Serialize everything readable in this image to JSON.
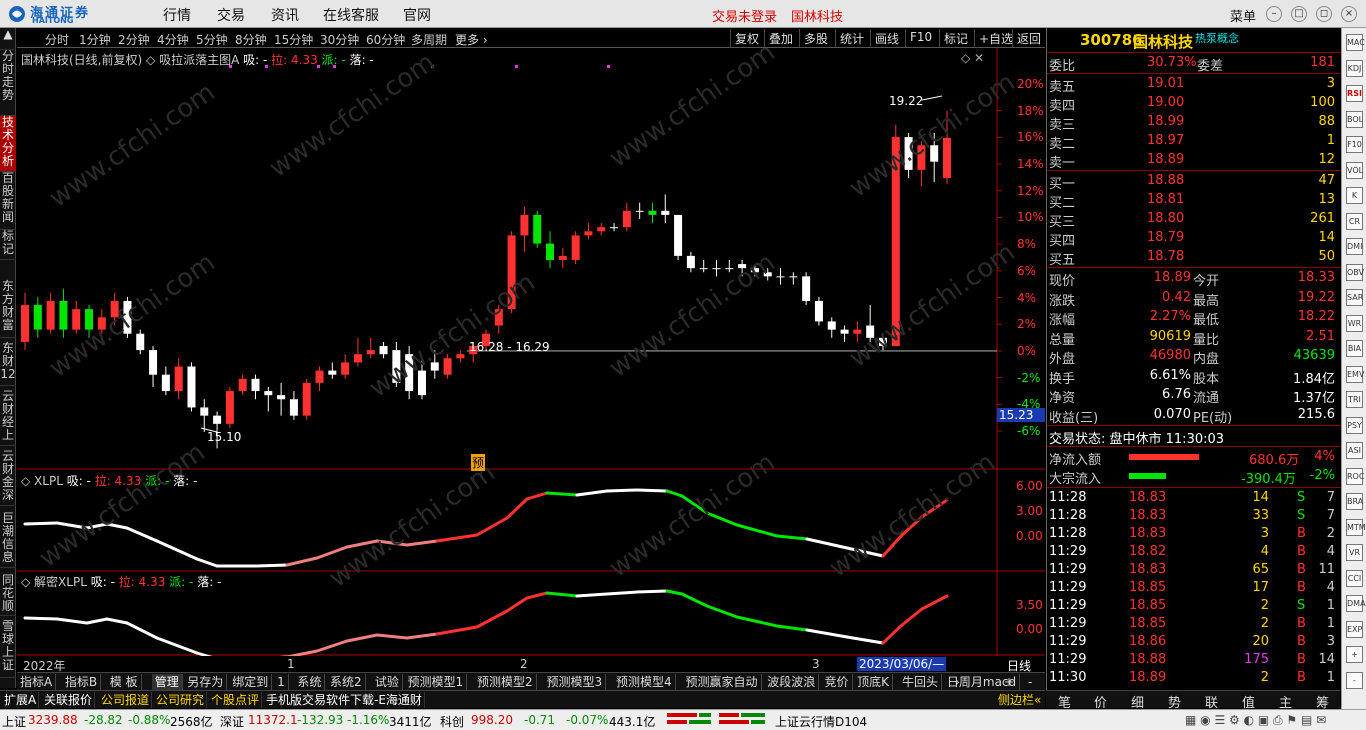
{
  "topbar": {
    "logo_cn": "海通证券",
    "logo_en": "HAITONG",
    "menus": [
      "行情",
      "交易",
      "资讯",
      "在线客服",
      "官网"
    ],
    "login_text": "交易未登录",
    "stock_name": "国林科技",
    "menu_label": "菜单"
  },
  "left_tabs": [
    "分时走势",
    "技术分析",
    "百股新闻",
    "标记",
    "东方财富",
    "东财12",
    "云财经上",
    "云财金深",
    "巨潮信息",
    "同花顺",
    "雪球上证"
  ],
  "periods": [
    "分时",
    "1分钟",
    "2分钟",
    "4分钟",
    "5分钟",
    "8分钟",
    "15分钟",
    "30分钟",
    "60分钟",
    "多周期",
    "更多"
  ],
  "toolbar": [
    "复权",
    "叠加",
    "多股",
    "统计",
    "画线",
    "F10",
    "标记",
    "+自选",
    "返回"
  ],
  "main_chart": {
    "title_name": "国林科技(日线,前复权)",
    "indicator": "吸拉派落主图A",
    "xi": "吸: -",
    "la": "拉: 4.33",
    "pai": "派: -",
    "luo": "落: -",
    "high_label": "19.22",
    "low_label": "15.10",
    "line_label": "16.28 - 16.29",
    "yu_marker": "预",
    "current_price_tag": "15.23",
    "axis_labels": [
      "20%",
      "18%",
      "16%",
      "14%",
      "12%",
      "10%",
      "8%",
      "6%",
      "4%",
      "2%",
      "0%",
      "-2%",
      "-4%",
      "-6%"
    ]
  },
  "chart_data": {
    "type": "candlestick",
    "ylim_percent": [
      -6,
      20
    ],
    "base_price": 16.29,
    "candles": [
      {
        "o": 16.4,
        "c": 16.85,
        "h": 17.0,
        "l": 16.3
      },
      {
        "o": 16.85,
        "c": 16.55,
        "h": 16.95,
        "l": 16.45
      },
      {
        "o": 16.55,
        "c": 16.9,
        "h": 17.0,
        "l": 16.5
      },
      {
        "o": 16.9,
        "c": 16.55,
        "h": 17.05,
        "l": 16.45
      },
      {
        "o": 16.55,
        "c": 16.8,
        "h": 16.9,
        "l": 16.5
      },
      {
        "o": 16.8,
        "c": 16.55,
        "h": 16.85,
        "l": 16.45
      },
      {
        "o": 16.55,
        "c": 16.7,
        "h": 16.8,
        "l": 16.5
      },
      {
        "o": 16.7,
        "c": 16.9,
        "h": 17.0,
        "l": 16.6
      },
      {
        "o": 16.9,
        "c": 16.5,
        "h": 16.95,
        "l": 16.45
      },
      {
        "o": 16.5,
        "c": 16.3,
        "h": 16.55,
        "l": 16.25
      },
      {
        "o": 16.3,
        "c": 16.0,
        "h": 16.35,
        "l": 15.85
      },
      {
        "o": 16.0,
        "c": 15.8,
        "h": 16.1,
        "l": 15.75
      },
      {
        "o": 15.8,
        "c": 16.1,
        "h": 16.2,
        "l": 15.7
      },
      {
        "o": 16.1,
        "c": 15.6,
        "h": 16.15,
        "l": 15.55
      },
      {
        "o": 15.6,
        "c": 15.5,
        "h": 15.7,
        "l": 15.3
      },
      {
        "o": 15.5,
        "c": 15.4,
        "h": 15.55,
        "l": 15.1
      },
      {
        "o": 15.4,
        "c": 15.8,
        "h": 15.85,
        "l": 15.35
      },
      {
        "o": 15.8,
        "c": 15.95,
        "h": 16.0,
        "l": 15.75
      },
      {
        "o": 15.95,
        "c": 15.8,
        "h": 16.0,
        "l": 15.7
      },
      {
        "o": 15.8,
        "c": 15.75,
        "h": 15.85,
        "l": 15.55
      },
      {
        "o": 15.75,
        "c": 15.7,
        "h": 15.9,
        "l": 15.5
      },
      {
        "o": 15.7,
        "c": 15.5,
        "h": 15.8,
        "l": 15.45
      },
      {
        "o": 15.5,
        "c": 15.9,
        "h": 15.95,
        "l": 15.45
      },
      {
        "o": 15.9,
        "c": 16.05,
        "h": 16.1,
        "l": 15.8
      },
      {
        "o": 16.05,
        "c": 16.0,
        "h": 16.15,
        "l": 15.95
      },
      {
        "o": 16.0,
        "c": 16.15,
        "h": 16.25,
        "l": 15.95
      },
      {
        "o": 16.15,
        "c": 16.25,
        "h": 16.45,
        "l": 16.1
      },
      {
        "o": 16.25,
        "c": 16.3,
        "h": 16.45,
        "l": 16.2
      },
      {
        "o": 16.35,
        "c": 16.25,
        "h": 16.4,
        "l": 16.2
      },
      {
        "o": 16.3,
        "c": 15.9,
        "h": 16.4,
        "l": 15.85
      },
      {
        "o": 16.25,
        "c": 15.8,
        "h": 16.35,
        "l": 15.7
      },
      {
        "o": 16.05,
        "c": 15.75,
        "h": 16.2,
        "l": 15.7
      },
      {
        "o": 16.15,
        "c": 16.05,
        "h": 16.3,
        "l": 15.95
      },
      {
        "o": 16.0,
        "c": 16.2,
        "h": 16.25,
        "l": 15.95
      },
      {
        "o": 16.2,
        "c": 16.25,
        "h": 16.3,
        "l": 16.15
      },
      {
        "o": 16.25,
        "c": 16.35,
        "h": 16.4,
        "l": 16.15
      },
      {
        "o": 16.35,
        "c": 16.5,
        "h": 16.55,
        "l": 16.3
      },
      {
        "o": 16.6,
        "c": 16.8,
        "h": 16.85,
        "l": 16.5
      },
      {
        "o": 16.8,
        "c": 17.7,
        "h": 17.75,
        "l": 16.75
      },
      {
        "o": 17.7,
        "c": 17.95,
        "h": 18.05,
        "l": 17.5
      },
      {
        "o": 17.95,
        "c": 17.6,
        "h": 18.0,
        "l": 17.55
      },
      {
        "o": 17.6,
        "c": 17.4,
        "h": 17.75,
        "l": 17.3
      },
      {
        "o": 17.4,
        "c": 17.45,
        "h": 17.55,
        "l": 17.3
      },
      {
        "o": 17.4,
        "c": 17.7,
        "h": 17.75,
        "l": 17.35
      },
      {
        "o": 17.7,
        "c": 17.75,
        "h": 17.85,
        "l": 17.65
      },
      {
        "o": 17.75,
        "c": 17.8,
        "h": 17.85,
        "l": 17.7
      },
      {
        "o": 17.8,
        "c": 17.8,
        "h": 17.85,
        "l": 17.75
      },
      {
        "o": 17.8,
        "c": 18.0,
        "h": 18.1,
        "l": 17.75
      },
      {
        "o": 18.0,
        "c": 18.0,
        "h": 18.1,
        "l": 17.9
      },
      {
        "o": 18.0,
        "c": 17.95,
        "h": 18.1,
        "l": 17.85
      },
      {
        "o": 18.0,
        "c": 17.95,
        "h": 18.2,
        "l": 17.85
      },
      {
        "o": 17.95,
        "c": 17.45,
        "h": 17.95,
        "l": 17.4
      },
      {
        "o": 17.45,
        "c": 17.3,
        "h": 17.5,
        "l": 17.25
      },
      {
        "o": 17.3,
        "c": 17.3,
        "h": 17.4,
        "l": 17.25
      },
      {
        "o": 17.3,
        "c": 17.3,
        "h": 17.4,
        "l": 17.2
      },
      {
        "o": 17.3,
        "c": 17.3,
        "h": 17.4,
        "l": 17.25
      },
      {
        "o": 17.35,
        "c": 17.3,
        "h": 17.4,
        "l": 17.2
      },
      {
        "o": 17.3,
        "c": 17.25,
        "h": 17.35,
        "l": 17.2
      },
      {
        "o": 17.25,
        "c": 17.2,
        "h": 17.3,
        "l": 17.15
      },
      {
        "o": 17.2,
        "c": 17.2,
        "h": 17.3,
        "l": 17.1
      },
      {
        "o": 17.2,
        "c": 17.2,
        "h": 17.25,
        "l": 17.1
      },
      {
        "o": 17.2,
        "c": 16.9,
        "h": 17.25,
        "l": 16.85
      },
      {
        "o": 16.9,
        "c": 16.65,
        "h": 16.95,
        "l": 16.6
      },
      {
        "o": 16.65,
        "c": 16.55,
        "h": 16.7,
        "l": 16.45
      },
      {
        "o": 16.55,
        "c": 16.5,
        "h": 16.6,
        "l": 16.4
      },
      {
        "o": 16.5,
        "c": 16.55,
        "h": 16.65,
        "l": 16.4
      },
      {
        "o": 16.6,
        "c": 16.45,
        "h": 16.85,
        "l": 16.4
      },
      {
        "o": 16.45,
        "c": 16.35,
        "h": 16.5,
        "l": 16.3
      },
      {
        "o": 16.35,
        "c": 18.9,
        "h": 19.05,
        "l": 16.35
      },
      {
        "o": 18.9,
        "c": 18.5,
        "h": 18.95,
        "l": 18.4
      },
      {
        "o": 18.5,
        "c": 18.8,
        "h": 18.85,
        "l": 18.3
      },
      {
        "o": 18.8,
        "c": 18.6,
        "h": 18.95,
        "l": 18.35
      },
      {
        "o": 18.4,
        "c": 18.89,
        "h": 19.22,
        "l": 18.33
      }
    ]
  },
  "sub1": {
    "name": "XLPL",
    "xi": "吸: -",
    "la": "拉: 4.33",
    "pai": "派: -",
    "luo": "落: -",
    "axis": [
      "6.00",
      "3.00",
      "0.00"
    ]
  },
  "sub2": {
    "name": "解密XLPL",
    "xi": "吸: -",
    "la": "拉: 4.33",
    "pai": "派: -",
    "luo": "落: -",
    "axis": [
      "3.50",
      "0.00"
    ]
  },
  "date_axis": [
    "2022年",
    "1",
    "2",
    "3",
    "2023/03/06/—",
    "日线"
  ],
  "bottom_tabs": [
    "指标A",
    "指标B",
    "模 板",
    "管理",
    "另存为",
    "绑定到",
    "1",
    "系统",
    "系统2",
    "试验",
    "预测模型1",
    "预测模型2",
    "预测模型3",
    "预测模型4",
    "预测赢家自动",
    "波段波浪",
    "竞价",
    "顶底K",
    "牛回头",
    "日周月macd"
  ],
  "ext_bar": [
    "扩展A",
    "关联报价",
    "公司报道",
    "公司研究",
    "个股点评",
    "手机版交易软件下载-E海通财"
  ],
  "ext_right": "侧边栏",
  "quote": {
    "code": "300786",
    "name": "国林科技",
    "concept": "热泵概念",
    "weibi_label": "委比",
    "weibi": "30.73%",
    "weicha_label": "委差",
    "weicha": "181",
    "asks": [
      {
        "label": "卖五",
        "price": "19.01",
        "vol": "3"
      },
      {
        "label": "卖四",
        "price": "19.00",
        "vol": "100"
      },
      {
        "label": "卖三",
        "price": "18.99",
        "vol": "88"
      },
      {
        "label": "卖二",
        "price": "18.97",
        "vol": "1"
      },
      {
        "label": "卖一",
        "price": "18.89",
        "vol": "12"
      }
    ],
    "bids": [
      {
        "label": "买一",
        "price": "18.88",
        "vol": "47"
      },
      {
        "label": "买二",
        "price": "18.81",
        "vol": "13"
      },
      {
        "label": "买三",
        "price": "18.80",
        "vol": "261"
      },
      {
        "label": "买四",
        "price": "18.79",
        "vol": "14"
      },
      {
        "label": "买五",
        "price": "18.78",
        "vol": "50"
      }
    ],
    "stats": [
      {
        "l1": "现价",
        "v1": "18.89",
        "l2": "今开",
        "v2": "18.33",
        "c1": "r",
        "c2": "r"
      },
      {
        "l1": "涨跌",
        "v1": "0.42",
        "l2": "最高",
        "v2": "19.22",
        "c1": "r",
        "c2": "r"
      },
      {
        "l1": "涨幅",
        "v1": "2.27%",
        "l2": "最低",
        "v2": "18.22",
        "c1": "r",
        "c2": "r"
      },
      {
        "l1": "总量",
        "v1": "90619",
        "l2": "量比",
        "v2": "2.51",
        "c1": "y",
        "c2": "r"
      },
      {
        "l1": "外盘",
        "v1": "46980",
        "l2": "内盘",
        "v2": "43639",
        "c1": "r",
        "c2": "g"
      },
      {
        "l1": "换手",
        "v1": "6.61%",
        "l2": "股本",
        "v2": "1.84亿",
        "c1": "w",
        "c2": "w"
      },
      {
        "l1": "净资",
        "v1": "6.76",
        "l2": "流通",
        "v2": "1.37亿",
        "c1": "w",
        "c2": "w"
      },
      {
        "l1": "收益(三)",
        "v1": "0.070",
        "l2": "PE(动)",
        "v2": "215.6",
        "c1": "w",
        "c2": "w"
      }
    ],
    "trade_status": "交易状态: 盘中休市 11:30:03",
    "flow_in_label": "净流入额",
    "flow_in": "680.6万",
    "flow_in_pct": "4%",
    "flow_in_ratio": 0.85,
    "big_in_label": "大宗流入",
    "big_in": "-390.4万",
    "big_in_pct": "-2%",
    "big_in_ratio": 0.45,
    "ticks": [
      {
        "t": "11:28",
        "p": "18.83",
        "v": "14",
        "s": "S",
        "n": "7"
      },
      {
        "t": "11:28",
        "p": "18.83",
        "v": "33",
        "s": "S",
        "n": "7"
      },
      {
        "t": "11:28",
        "p": "18.83",
        "v": "3",
        "s": "B",
        "n": "2"
      },
      {
        "t": "11:29",
        "p": "18.82",
        "v": "4",
        "s": "B",
        "n": "4"
      },
      {
        "t": "11:29",
        "p": "18.83",
        "v": "65",
        "s": "B",
        "n": "11"
      },
      {
        "t": "11:29",
        "p": "18.85",
        "v": "17",
        "s": "B",
        "n": "4"
      },
      {
        "t": "11:29",
        "p": "18.85",
        "v": "2",
        "s": "S",
        "n": "1"
      },
      {
        "t": "11:29",
        "p": "18.85",
        "v": "2",
        "s": "B",
        "n": "1"
      },
      {
        "t": "11:29",
        "p": "18.86",
        "v": "20",
        "s": "B",
        "n": "3"
      },
      {
        "t": "11:29",
        "p": "18.88",
        "v": "175",
        "s": "B",
        "n": "14"
      },
      {
        "t": "11:30",
        "p": "18.89",
        "v": "2",
        "s": "B",
        "n": "1"
      }
    ],
    "bottom_tabs": [
      "笔",
      "价",
      "细",
      "势",
      "联",
      "值",
      "主",
      "筹"
    ]
  },
  "status": {
    "sh_label": "上证",
    "sh_value": "3239.88",
    "sh_change": "-28.82",
    "sh_pct": "-0.88%",
    "sh_amount": "2568亿",
    "sz_label": "深证",
    "sz_value": "11372.1",
    "sz_change": "-132.93",
    "sz_pct": "-1.16%",
    "sz_amount": "3411亿",
    "kc_label": "科创",
    "kc_value": "998.20",
    "kc_change": "-0.71",
    "kc_pct": "-0.07%",
    "kc_amount": "443.1亿",
    "cloud": "上证云行情D104"
  },
  "right_tools": [
    "MACD",
    "KDJ",
    "RSI",
    "BOLL",
    "F10",
    "VOL",
    "K",
    "CR",
    "DMI",
    "OBV",
    "SAR",
    "WR",
    "BIAS",
    "EMV",
    "TRIX",
    "PSY",
    "ASI",
    "ROC",
    "BRAR",
    "MTM",
    "VR",
    "CCI",
    "DMA",
    "EXPMA",
    "+",
    "-"
  ],
  "watermark": "www.cfchi.com",
  "colors": {
    "up": "#ff3232",
    "down": "#00e600",
    "flat": "#ffffff",
    "bg": "#000000"
  }
}
